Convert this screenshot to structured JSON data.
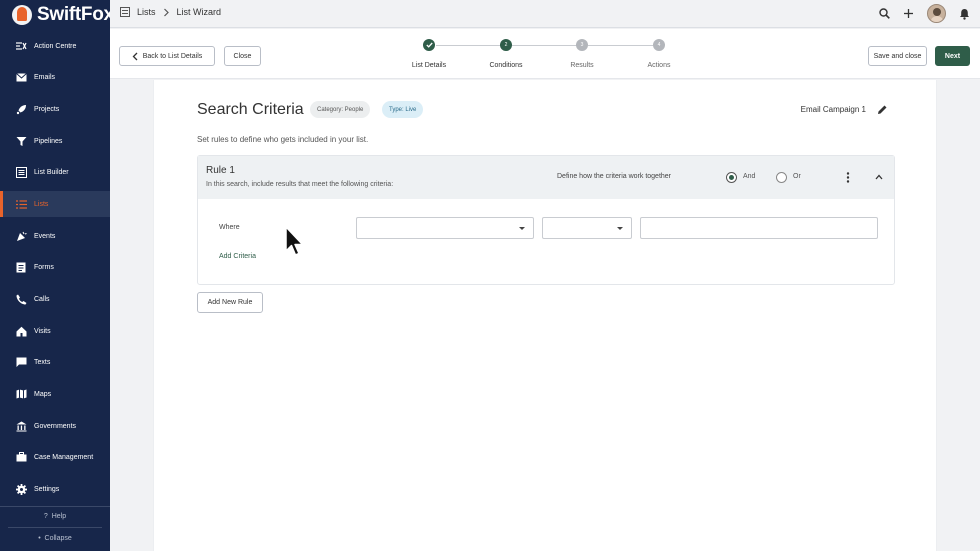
{
  "app": {
    "name": "SwiftFox"
  },
  "sidebar": {
    "items": [
      {
        "label": "Action Centre",
        "icon": "action-centre-icon",
        "active": false
      },
      {
        "label": "Emails",
        "icon": "email-icon",
        "active": false
      },
      {
        "label": "Projects",
        "icon": "rocket-icon",
        "active": false
      },
      {
        "label": "Pipelines",
        "icon": "funnel-icon",
        "active": false
      },
      {
        "label": "List Builder",
        "icon": "list-builder-icon",
        "active": false
      },
      {
        "label": "Lists",
        "icon": "list-icon",
        "active": true
      },
      {
        "label": "Events",
        "icon": "party-icon",
        "active": false
      },
      {
        "label": "Forms",
        "icon": "form-icon",
        "active": false
      },
      {
        "label": "Calls",
        "icon": "phone-icon",
        "active": false
      },
      {
        "label": "Visits",
        "icon": "house-icon",
        "active": false
      },
      {
        "label": "Texts",
        "icon": "chat-icon",
        "active": false
      },
      {
        "label": "Maps",
        "icon": "map-icon",
        "active": false
      },
      {
        "label": "Governments",
        "icon": "government-icon",
        "active": false
      },
      {
        "label": "Case Management",
        "icon": "briefcase-icon",
        "active": false
      },
      {
        "label": "Settings",
        "icon": "gear-icon",
        "active": false
      }
    ],
    "help": "Help",
    "collapse": "Collapse"
  },
  "topbar": {
    "breadcrumb": [
      "Lists",
      "List Wizard"
    ]
  },
  "wizard": {
    "back_label": "Back to List Details",
    "close_label": "Close",
    "save_close_label": "Save and close",
    "next_label": "Next",
    "steps": [
      {
        "number": "1",
        "label": "List Details",
        "state": "done"
      },
      {
        "number": "2",
        "label": "Conditions",
        "state": "current"
      },
      {
        "number": "3",
        "label": "Results",
        "state": "todo"
      },
      {
        "number": "4",
        "label": "Actions",
        "state": "todo"
      }
    ]
  },
  "main": {
    "title": "Search Criteria",
    "category_chip": "Category: People",
    "type_chip": "Type: Live",
    "campaign_name": "Email Campaign 1",
    "subtitle": "Set rules to define who gets included in your list.",
    "rule": {
      "title": "Rule 1",
      "description": "In this search, include results that meet the following criteria:",
      "define_label": "Define how the criteria work together",
      "and_label": "And",
      "or_label": "Or",
      "selected": "And",
      "where_label": "Where",
      "field_value": "",
      "operator_value": "",
      "value_input": "",
      "add_criteria_label": "Add Criteria"
    },
    "add_rule_label": "Add New Rule"
  },
  "colors": {
    "sidebar_bg": "#17264a",
    "accent": "#e8632b",
    "primary": "#2f5d49"
  }
}
